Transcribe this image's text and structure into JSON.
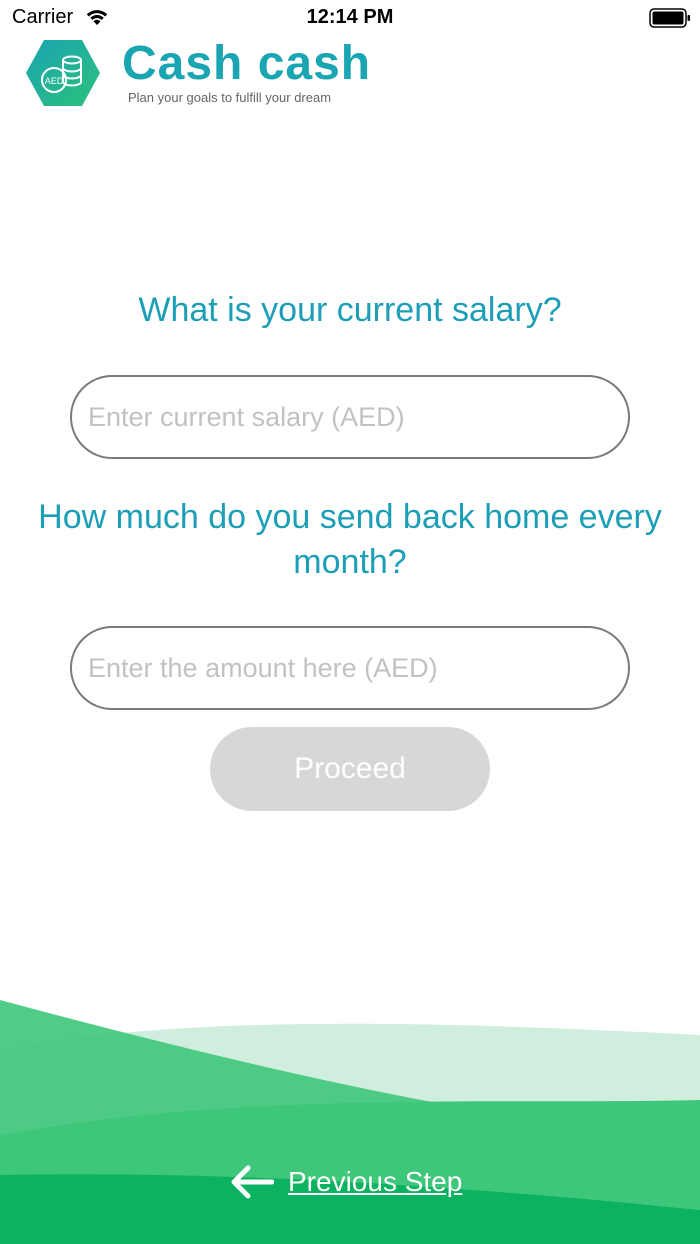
{
  "status_bar": {
    "carrier": "Carrier",
    "time": "12:14 PM",
    "icons": [
      "wifi-icon",
      "battery-icon"
    ]
  },
  "header": {
    "brand_name": "Cash cash",
    "tagline": "Plan your goals to fulfill your dream",
    "logo_badge": "AED"
  },
  "form": {
    "salary_question": "What is your current salary?",
    "salary_placeholder": "Enter current salary (AED)",
    "salary_value": "",
    "remit_question": "How much do you send back home every month?",
    "remit_placeholder": "Enter the amount here (AED)",
    "remit_value": "",
    "proceed_label": "Proceed"
  },
  "footer": {
    "previous_label": "Previous Step",
    "icon": "arrow-left-icon"
  },
  "colors": {
    "accent_teal": "#1aa5b3",
    "question_text": "#1c9fb6",
    "green_dark": "#0bb25f",
    "green_mid": "#3ec77a",
    "green_light": "#cfeedd",
    "button_disabled": "#d7d7d7"
  }
}
